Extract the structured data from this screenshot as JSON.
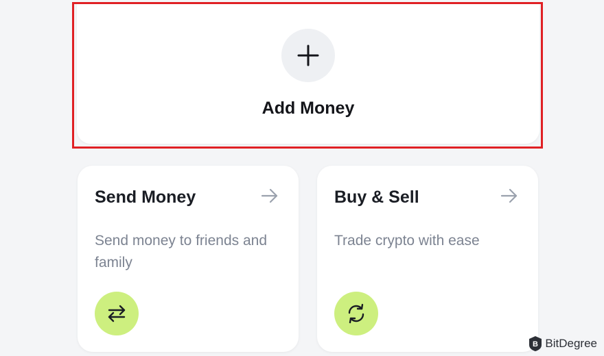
{
  "add_money": {
    "icon": "plus-icon",
    "label": "Add Money"
  },
  "cards": [
    {
      "title": "Send Money",
      "description": "Send money to friends and family",
      "arrow_icon": "arrow-right-icon",
      "icon": "swap-arrows-icon"
    },
    {
      "title": "Buy & Sell",
      "description": "Trade crypto with ease",
      "arrow_icon": "arrow-right-icon",
      "icon": "refresh-icon"
    }
  ],
  "watermark": {
    "text": "BitDegree"
  },
  "colors": {
    "background": "#f4f5f7",
    "card": "#ffffff",
    "highlight_border": "#e02024",
    "accent_green": "#cdef7f",
    "plus_circle": "#eef0f3",
    "title_text": "#1a1d24",
    "description_text": "#7c8391",
    "arrow": "#9aa1ad"
  }
}
